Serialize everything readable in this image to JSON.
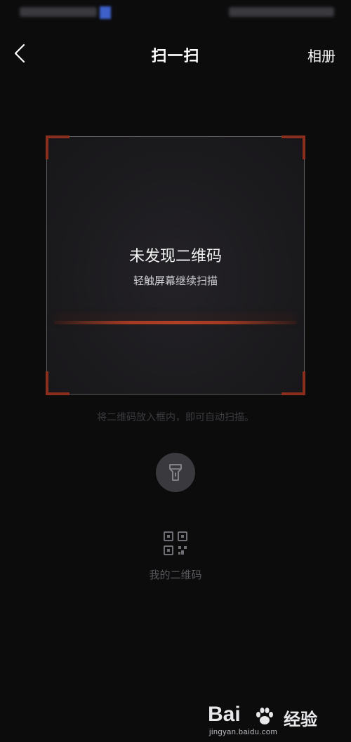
{
  "header": {
    "title": "扫一扫",
    "album_label": "相册",
    "back_icon": "chevron-left-icon"
  },
  "scanner": {
    "status": "未发现二维码",
    "hint": "轻触屏幕继续扫描",
    "instruction": "将二维码放入框内，即可自动扫描。",
    "accent_color": "#8b2e1d"
  },
  "controls": {
    "flashlight_icon": "flashlight-icon",
    "qr_icon": "qr-code-icon",
    "my_qr_label": "我的二维码"
  },
  "watermark": {
    "brand": "Bai",
    "brand_suffix": "经验",
    "url": "jingyan.baidu.com"
  }
}
